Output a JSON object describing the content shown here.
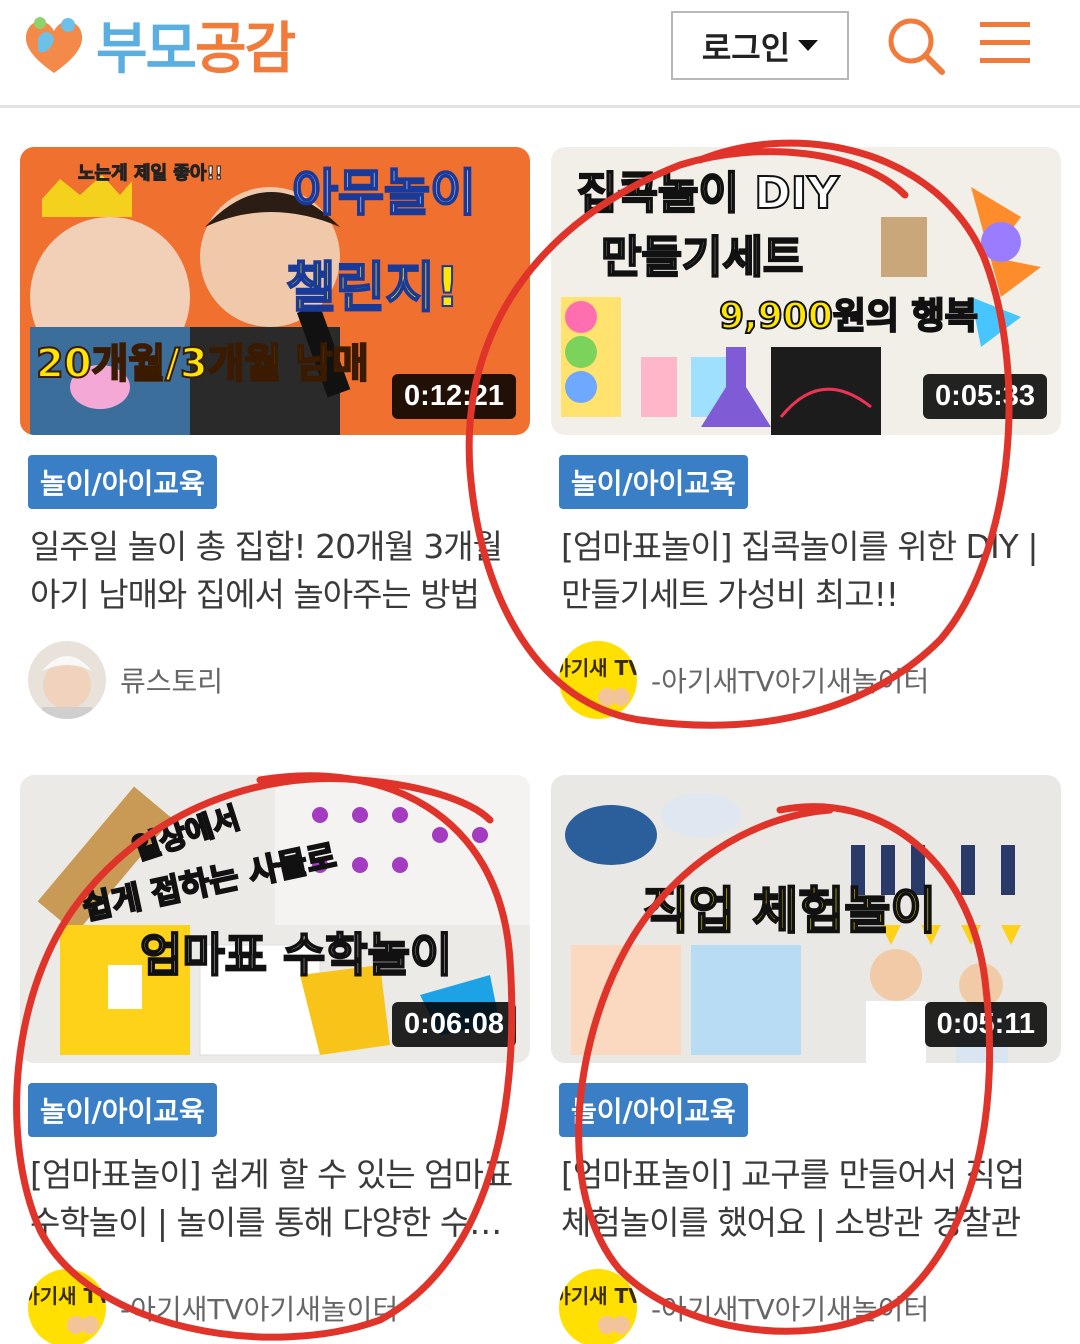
{
  "header": {
    "logo_text_a": "부모",
    "logo_text_b": "공감",
    "login_label": "로그인",
    "search_icon": "search-icon",
    "menu_icon": "hamburger-menu-icon"
  },
  "colors": {
    "brand_blue": "#5aaee0",
    "brand_orange": "#f07b3a",
    "category_badge": "#3a7fc6",
    "annotation_red": "#e0342a"
  },
  "videos": [
    {
      "thumb_texts": [
        "아무놀이",
        "챌린지!",
        "20개월/3개월 남매",
        "노는게 제일 좋아!!"
      ],
      "duration": "0:12:21",
      "category": "놀이/아이교육",
      "title": "일주일 놀이 총 집합! 20개월 3개월 아기 남매와 집에서 놀아주는 방법",
      "author": "류스토리"
    },
    {
      "thumb_texts": [
        "집콕놀이 DIY",
        "만들기세트",
        "9,900원의 행복"
      ],
      "duration": "0:05:33",
      "category": "놀이/아이교육",
      "title": "[엄마표놀이] 집콕놀이를 위한 DIY | 만들기세트 가성비 최고!!",
      "author": "-아기새TV아기새놀이터",
      "avatar_text": "아기새 TV"
    },
    {
      "thumb_texts": [
        "일상에서",
        "쉽게 접하는 사물로",
        "엄마표 수학놀이"
      ],
      "duration": "0:06:08",
      "category": "놀이/아이교육",
      "title": "[엄마표놀이] 쉽게 할 수 있는 엄마표 수학놀이 | 놀이를 통해 다양한 수학 개념을",
      "author": "-아기새TV아기새놀이터",
      "avatar_text": "아기새 TV"
    },
    {
      "thumb_texts": [
        "직업 체험놀이"
      ],
      "duration": "0:05:11",
      "category": "놀이/아이교육",
      "title": "[엄마표놀이] 교구를 만들어서 직업체험놀이를 했어요 | 소방관 경찰관",
      "author": "-아기새TV아기새놀이터",
      "avatar_text": "아기새 TV"
    }
  ]
}
